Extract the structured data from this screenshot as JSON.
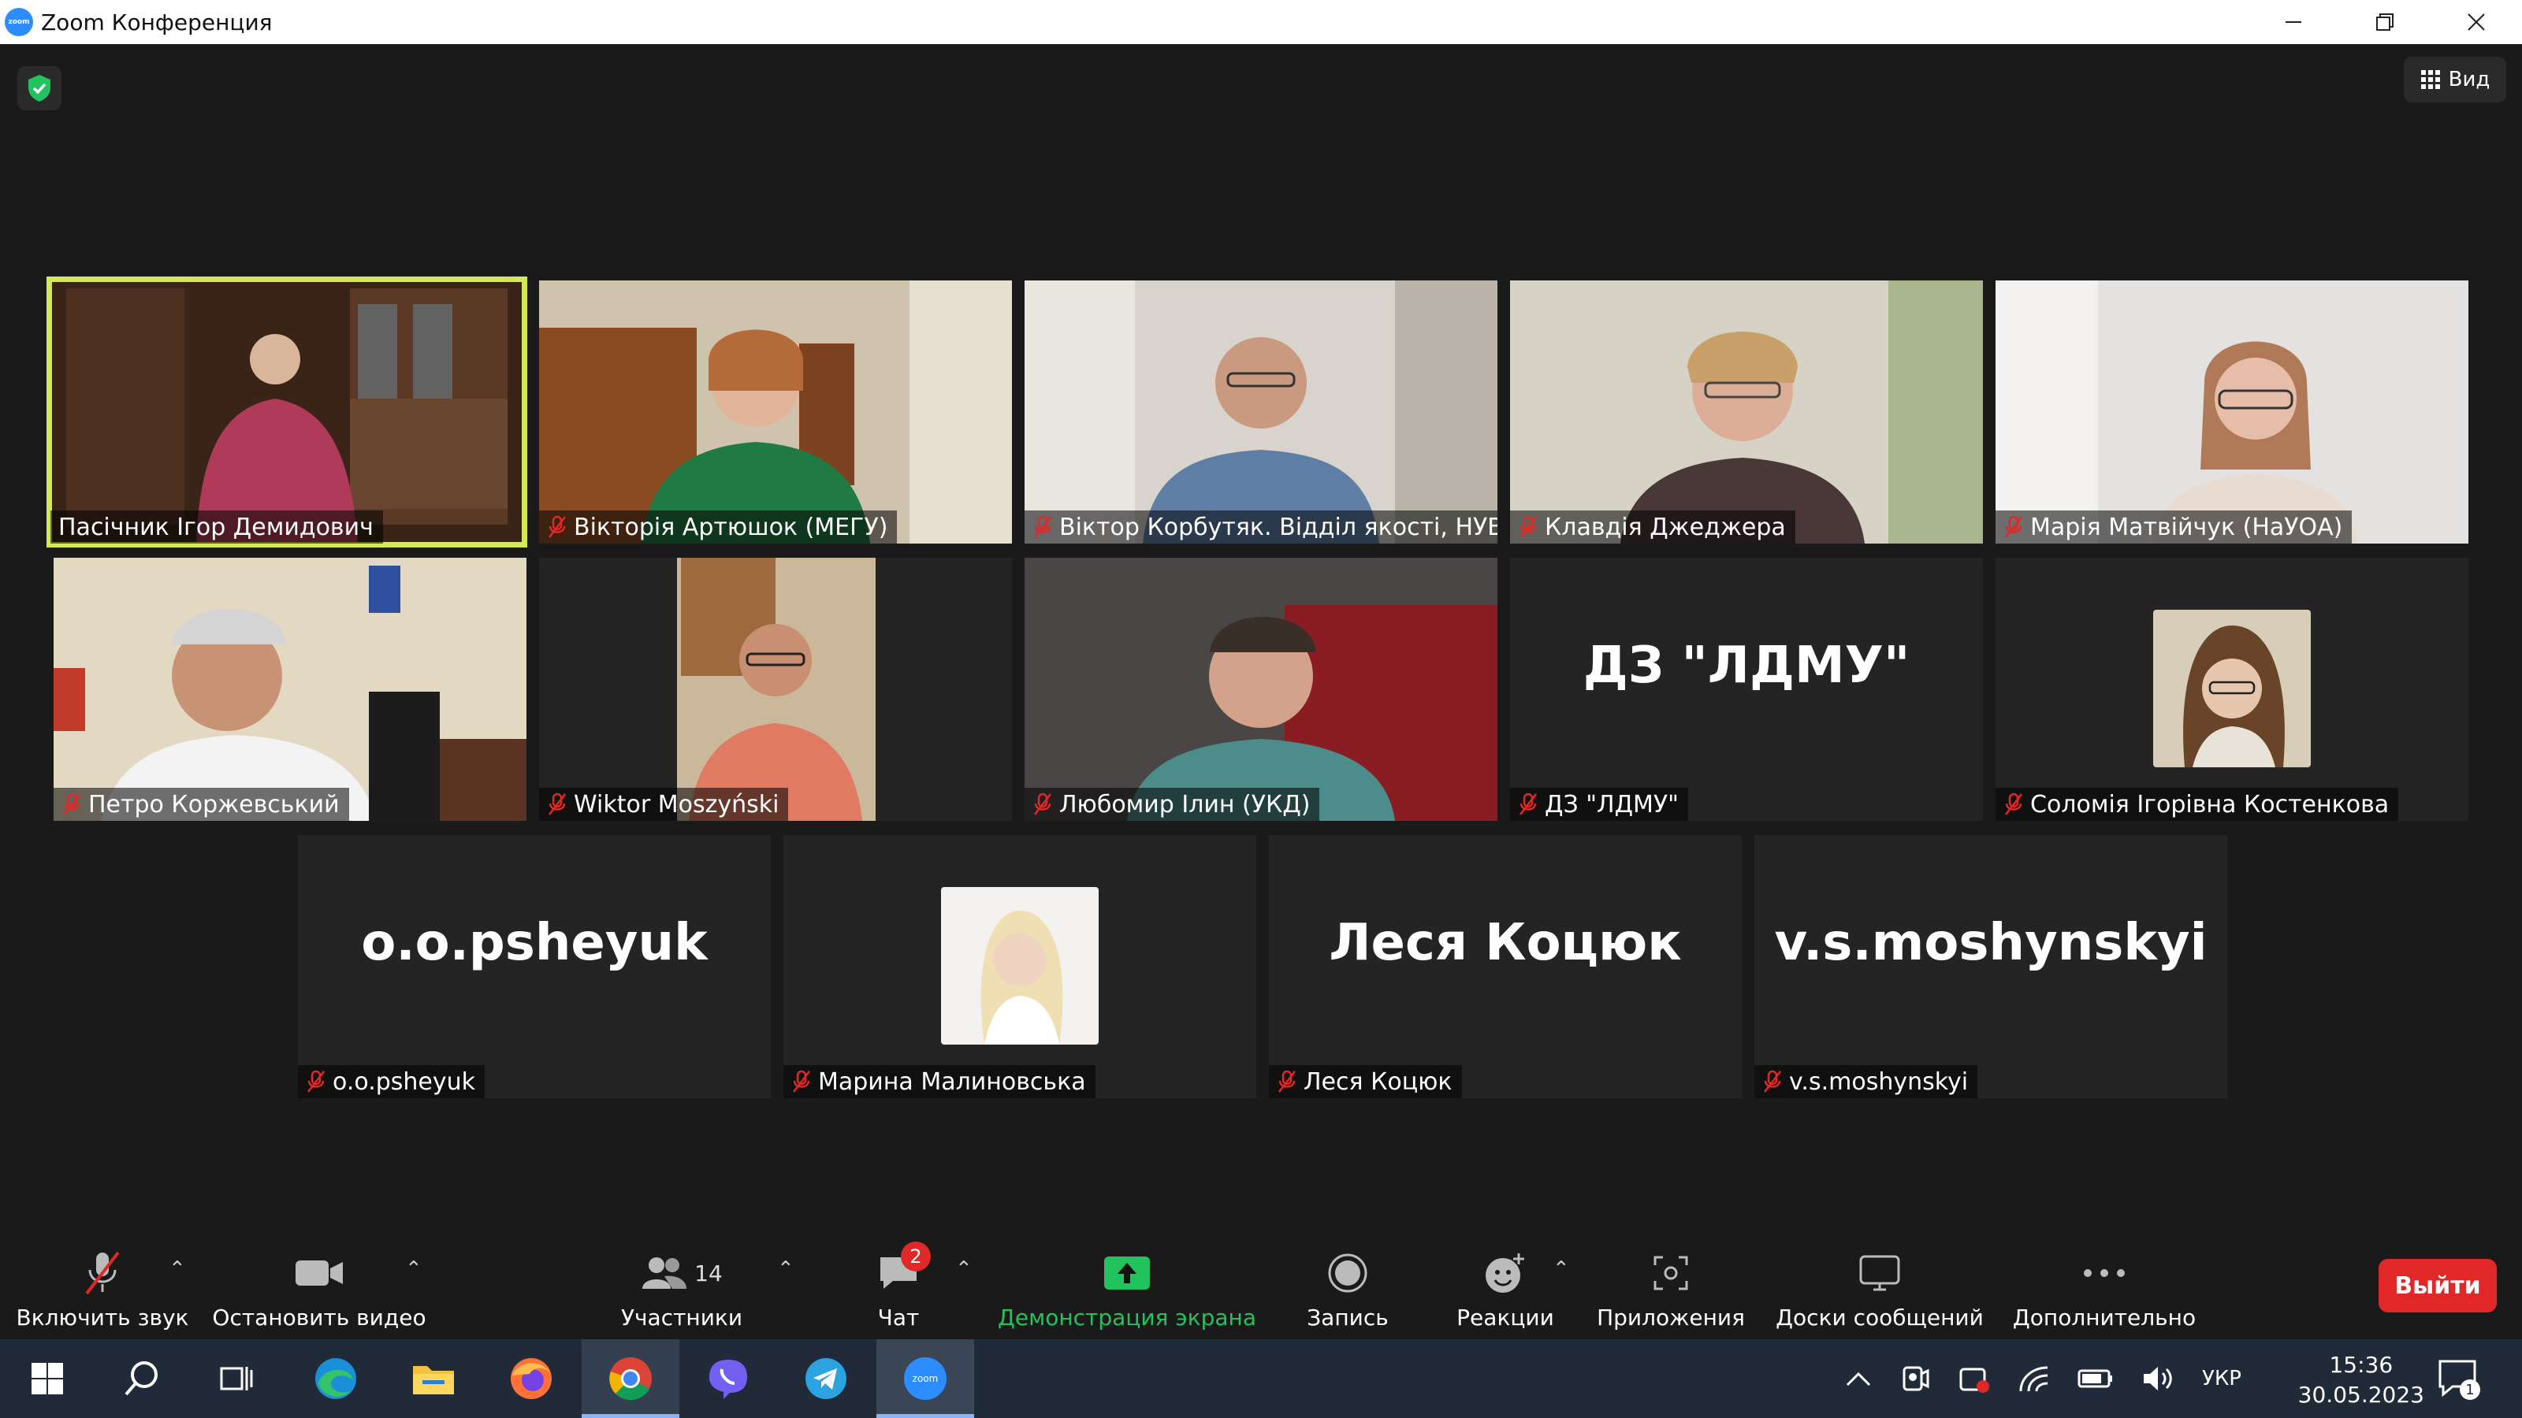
{
  "window": {
    "title": "Zoom Конференция",
    "logo_text": "zoom",
    "controls": [
      "minimize-icon",
      "restore-icon",
      "close-icon"
    ]
  },
  "header": {
    "view_label": "Вид"
  },
  "participants": [
    {
      "name": "Пасічник Ігор Демидович",
      "muted": false,
      "video": true,
      "active": true
    },
    {
      "name": "Вікторія Артюшок (МЕГУ)",
      "muted": true,
      "video": true
    },
    {
      "name": "Віктор Корбутяк. Відділ якості, НУВГП.",
      "muted": true,
      "video": true
    },
    {
      "name": "Клавдія Джеджера",
      "muted": true,
      "video": true
    },
    {
      "name": "Марія Матвійчук (НаУОА)",
      "muted": true,
      "video": true
    },
    {
      "name": "Петро Коржевський",
      "muted": true,
      "video": true
    },
    {
      "name": "Wiktor Moszyński",
      "muted": true,
      "video": true
    },
    {
      "name": "Любомир Ілин (УКД)",
      "muted": true,
      "video": true
    },
    {
      "name": "ДЗ \"ЛДМУ\"",
      "muted": true,
      "video": false,
      "display_name": "ДЗ \"ЛДМУ\""
    },
    {
      "name": "Соломія Ігорівна Костенкова",
      "muted": true,
      "video": false,
      "avatar": true
    },
    {
      "name": "o.o.psheyuk",
      "muted": true,
      "video": false,
      "display_name": "o.o.psheyuk"
    },
    {
      "name": "Марина Малиновська",
      "muted": true,
      "video": false,
      "avatar": true
    },
    {
      "name": "Леся Коцюк",
      "muted": true,
      "video": false,
      "display_name": "Леся Коцюк"
    },
    {
      "name": "v.s.moshynskyi",
      "muted": true,
      "video": false,
      "display_name": "v.s.moshynskyi"
    }
  ],
  "toolbar": {
    "audio_label": "Включить звук",
    "video_label": "Остановить видео",
    "participants_label": "Участники",
    "participants_count": "14",
    "chat_label": "Чат",
    "chat_badge": "2",
    "share_label": "Демонстрация экрана",
    "record_label": "Запись",
    "reactions_label": "Реакции",
    "apps_label": "Приложения",
    "whiteboards_label": "Доски сообщений",
    "more_label": "Дополнительно",
    "leave_label": "Выйти"
  },
  "taskbar": {
    "apps": [
      "windows-start-icon",
      "search-icon",
      "task-view-icon",
      "edge-icon",
      "file-explorer-icon",
      "firefox-icon",
      "chrome-icon",
      "viber-icon",
      "telegram-icon",
      "zoom-icon"
    ],
    "active_app": "zoom-icon",
    "zoom_icon_text": "zoom",
    "language": "УКР",
    "time": "15:36",
    "date": "30.05.2023",
    "notifications_count": "1"
  },
  "colors": {
    "active_speaker": "#d5e85a",
    "leave": "#e02828",
    "share": "#22c35e",
    "brand": "#2d8cff"
  }
}
